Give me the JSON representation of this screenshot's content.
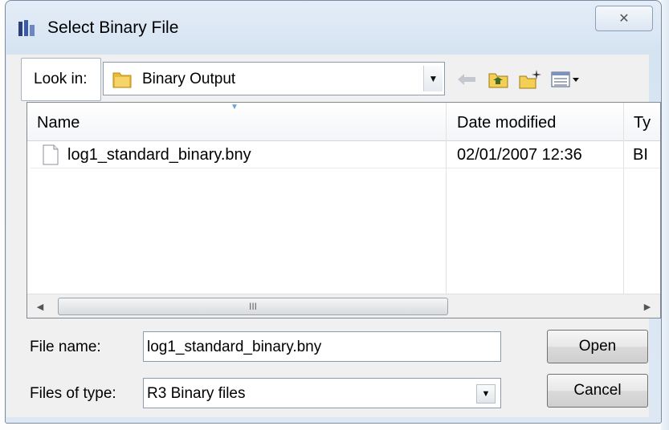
{
  "window": {
    "title": "Select Binary File",
    "close_symbol": "✕"
  },
  "look_in": {
    "label": "Look in:",
    "value": "Binary Output"
  },
  "toolbar": {
    "back_icon": "back-arrow-icon",
    "up_icon": "up-folder-icon",
    "new_folder_icon": "new-folder-icon",
    "view_menu_icon": "view-menu-icon"
  },
  "file_list": {
    "columns": [
      "Name",
      "Date modified",
      "Ty"
    ],
    "rows": [
      {
        "name": "log1_standard_binary.bny",
        "date": "02/01/2007 12:36",
        "type": "BI"
      }
    ],
    "scroll_grip": "III"
  },
  "file_name": {
    "label": "File name:",
    "value": "log1_standard_binary.bny"
  },
  "file_type": {
    "label": "Files of type:",
    "value": "R3 Binary files"
  },
  "buttons": {
    "open": "Open",
    "cancel": "Cancel"
  }
}
